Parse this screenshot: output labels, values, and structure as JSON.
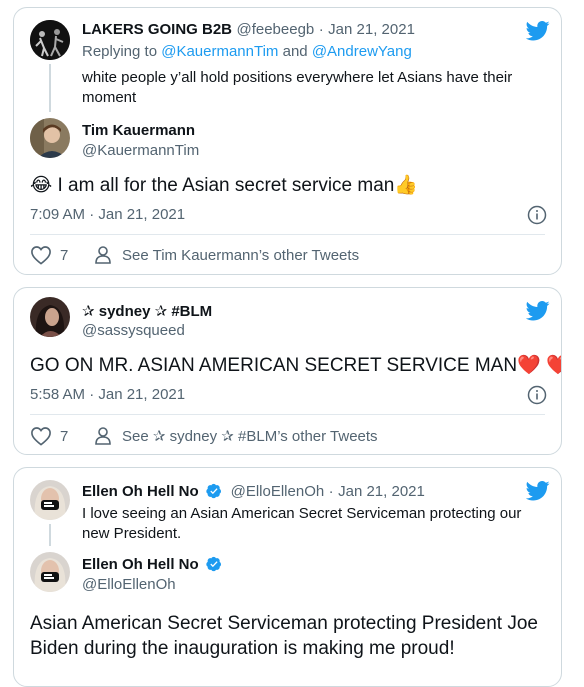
{
  "tweets": [
    {
      "parent": {
        "name": "LAKERS GOING B2B",
        "handle": "@feebeegb",
        "date": "Jan 21, 2021",
        "replying_label": "Replying to",
        "replying_to_1": "@KauermannTim",
        "replying_and": "and",
        "replying_to_2": "@AndrewYang",
        "text": "white people y’all hold positions everywhere let Asians have their moment"
      },
      "main": {
        "name": "Tim Kauermann",
        "handle": "@KauermannTim",
        "text_emoji_prefix": "😂",
        "text": "I am all for the Asian secret service man",
        "text_emoji_suffix": "👍",
        "time": "7:09 AM · Jan 21, 2021",
        "likes": "7",
        "see_other": "See Tim Kauermann’s other Tweets"
      }
    },
    {
      "main": {
        "name": "✰ sydney ✰ #BLM",
        "handle": "@sassysqueed",
        "text": "GO ON MR. ASIAN AMERICAN SECRET SERVICE MAN",
        "text_emoji_suffix": "❤️ ❤️",
        "time": "5:58 AM · Jan 21, 2021",
        "likes": "7",
        "see_other": "See ✰ sydney ✰ #BLM’s other Tweets"
      }
    },
    {
      "parent": {
        "name": "Ellen Oh Hell No",
        "handle": "@ElloEllenOh",
        "date": "Jan 21, 2021",
        "text": "I love seeing an Asian American Secret Serviceman protecting our new President."
      },
      "main": {
        "name": "Ellen Oh Hell No",
        "handle": "@ElloEllenOh",
        "text": "Asian American Secret Serviceman protecting President Joe Biden during the inauguration is making me proud!"
      }
    }
  ],
  "colors": {
    "twitter_blue": "#1d9bf0",
    "border": "#cfd9de",
    "secondary_text": "#536471",
    "heart_red": "#e0245e"
  },
  "icons": [
    "twitter-bird-icon",
    "heart-icon",
    "person-icon",
    "info-icon",
    "verified-badge-icon"
  ]
}
